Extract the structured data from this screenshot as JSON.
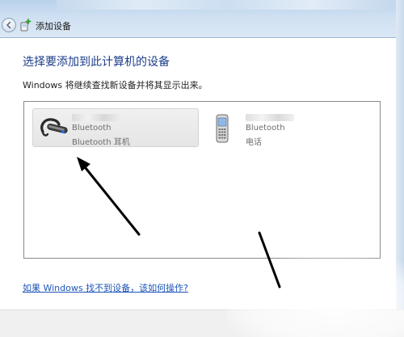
{
  "window": {
    "title": "添加设备"
  },
  "main": {
    "heading": "选择要添加到此计算机的设备",
    "subtext": "Windows 将继续查找新设备并将其显示出来。"
  },
  "devices": [
    {
      "line1": "Bluetooth",
      "line2": "Bluetooth 耳机",
      "icon": "headset-icon",
      "selected": true
    },
    {
      "line1": "Bluetooth",
      "line2": "电话",
      "icon": "phone-icon",
      "selected": false
    }
  ],
  "help_link": "如果 Windows 找不到设备，该如何操作?",
  "colors": {
    "heading": "#1d3e8a",
    "link": "#1d55b8",
    "arrow": "#000000"
  }
}
